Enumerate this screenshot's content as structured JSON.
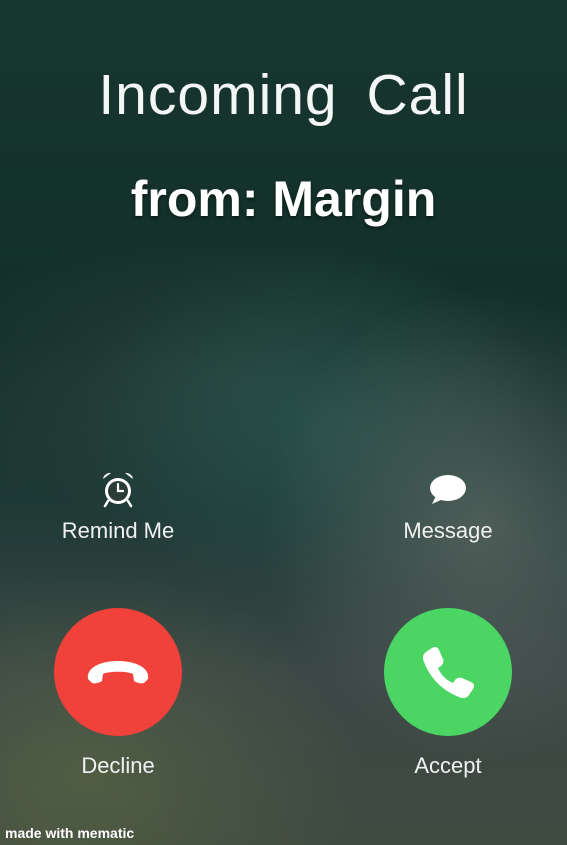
{
  "call": {
    "title": "Incoming  Call",
    "caller": "from: Margin"
  },
  "actions": {
    "remind": {
      "label": "Remind Me",
      "icon": "alarm-clock-icon"
    },
    "message": {
      "label": "Message",
      "icon": "speech-bubble-icon"
    },
    "decline": {
      "label": "Decline",
      "icon": "phone-hangup-icon",
      "color": "#f0413a"
    },
    "accept": {
      "label": "Accept",
      "icon": "phone-icon",
      "color": "#4bd563"
    }
  },
  "watermark": "made with mematic"
}
